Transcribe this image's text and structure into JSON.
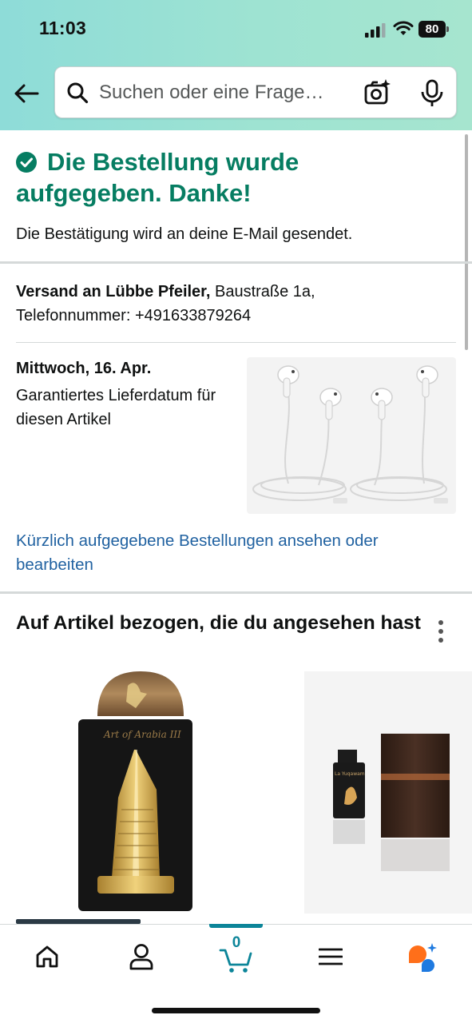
{
  "status_bar": {
    "time": "11:03",
    "battery": "80"
  },
  "search": {
    "placeholder": "Suchen oder eine Frage…"
  },
  "confirmation": {
    "title": "Die Bestellung wurde aufgegeben. Danke!",
    "subtitle": "Die Bestätigung wird an deine E-Mail gesendet."
  },
  "shipping": {
    "prefix": "Versand an Lübbe Pfeiler,",
    "address": " Baustraße 1a,",
    "phone": "Telefonnummer: +491633879264"
  },
  "delivery": {
    "date": "Mittwoch, 16. Apr.",
    "guarantee": "Garantiertes Lieferdatum für diesen Artikel"
  },
  "orders_link": "Kürzlich aufgegebene Bestellungen ansehen oder bearbeiten",
  "recommendations": {
    "title": "Auf Artikel bezogen, die du angesehen hast",
    "item1_brand": "Art of Arabia III",
    "item2_brand": "La Yuqawam"
  },
  "tabbar": {
    "items": [
      "home-icon",
      "account-icon",
      "cart-icon",
      "menu-icon",
      "rufus-ai-icon"
    ],
    "cart_count": "0"
  },
  "colors": {
    "header_gradient": "#8edcd8",
    "success_green": "#067d62",
    "link_blue": "#2162a1",
    "cart_teal": "#0c8599"
  }
}
